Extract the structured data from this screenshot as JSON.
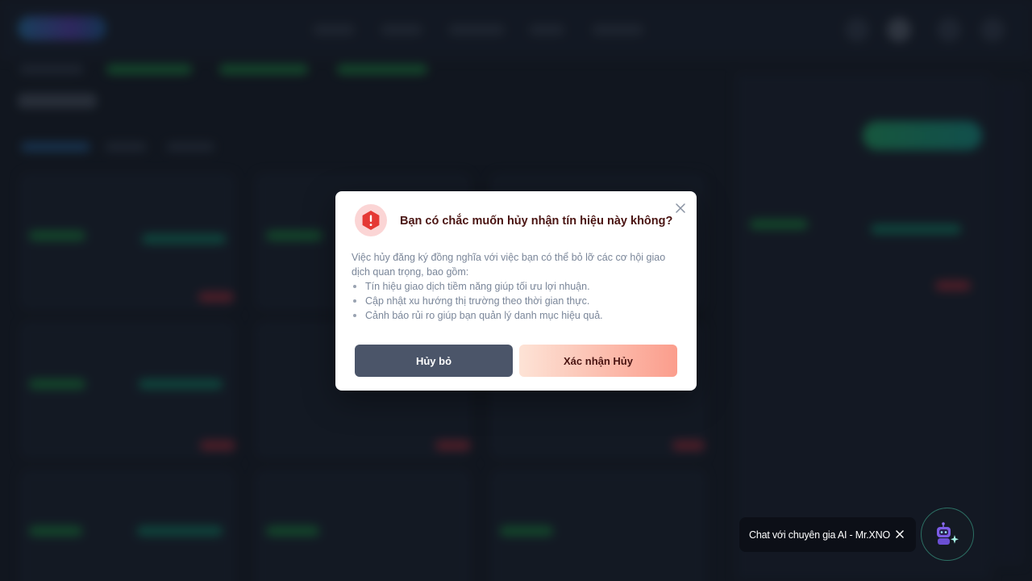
{
  "modal": {
    "title": "Bạn có chắc muốn hủy nhận tín hiệu này không?",
    "intro": "Việc hủy đăng ký đồng nghĩa với việc bạn có thể bỏ lỡ các cơ hội giao dịch quan trọng, bao gồm:",
    "bullets": [
      "Tín hiệu giao dịch tiềm năng giúp tối ưu lợi nhuận.",
      "Cập nhật xu hướng thị trường theo thời gian thực.",
      "Cảnh báo rủi ro giúp bạn quản lý danh mục hiệu quả."
    ],
    "cancel_label": "Hủy bỏ",
    "confirm_label": "Xác nhận Hủy",
    "warning_icon": "alert-hexagon-icon",
    "close_icon": "close-icon"
  },
  "chat": {
    "label": "Chat với chuyên gia AI - Mr.XNO",
    "close_icon": "close-icon",
    "bot_icon": "robot-icon"
  },
  "colors": {
    "title": "#4a1412",
    "cancel_button": "#4b5569",
    "confirm_gradient_start": "#fde3d6",
    "confirm_gradient_end": "#fb9d8c",
    "warning": "#e53935"
  }
}
